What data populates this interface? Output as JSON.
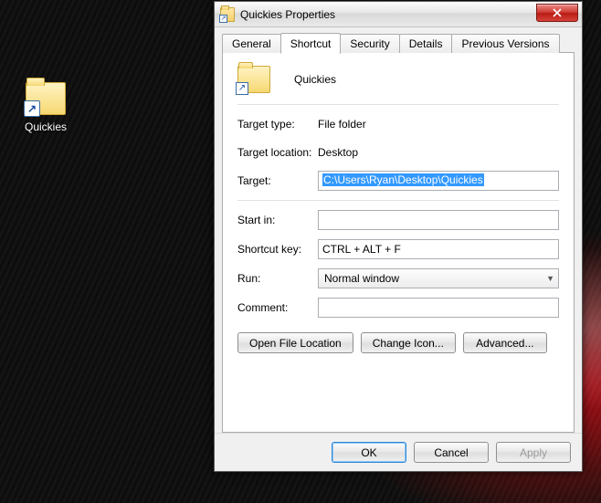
{
  "desktop_icon": {
    "label": "Quickies"
  },
  "window": {
    "title": "Quickies Properties",
    "tabs": [
      "General",
      "Shortcut",
      "Security",
      "Details",
      "Previous Versions"
    ],
    "active_tab_index": 1
  },
  "shortcut": {
    "name": "Quickies",
    "labels": {
      "target_type": "Target type:",
      "target_location": "Target location:",
      "target": "Target:",
      "start_in": "Start in:",
      "shortcut_key": "Shortcut key:",
      "run": "Run:",
      "comment": "Comment:"
    },
    "target_type": "File folder",
    "target_location": "Desktop",
    "target": "C:\\Users\\Ryan\\Desktop\\Quickies",
    "start_in": "",
    "shortcut_key": "CTRL + ALT + F",
    "run": "Normal window",
    "comment": ""
  },
  "buttons": {
    "open_file_location": "Open File Location",
    "change_icon": "Change Icon...",
    "advanced": "Advanced..."
  },
  "footer": {
    "ok": "OK",
    "cancel": "Cancel",
    "apply": "Apply"
  }
}
